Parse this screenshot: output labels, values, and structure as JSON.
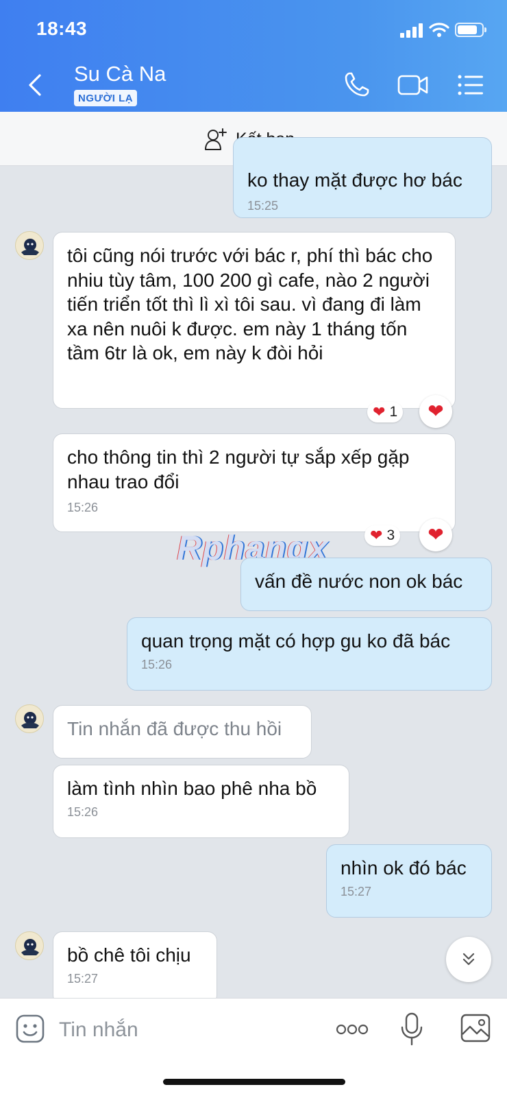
{
  "status_bar": {
    "time": "18:43"
  },
  "header": {
    "contact_name": "Su Cà Na",
    "badge": "NGƯỜI LẠ",
    "icons": [
      "back-icon",
      "phone-icon",
      "video-call-icon",
      "menu-list-icon"
    ]
  },
  "friend_bar": {
    "label": "Kết bạn",
    "icon": "add-friend-icon"
  },
  "messages": [
    {
      "dir": "out",
      "text": "ko thay mặt được hơ bác",
      "time": "15:25"
    },
    {
      "dir": "in",
      "text": "tôi cũng nói trước với bác r, phí thì bác cho nhiu tùy tâm, 100 200 gì cafe, nào 2 người tiến triển tốt thì lì xì tôi sau. vì đang đi làm xa nên nuôi k được. em này 1 tháng tốn tầm 6tr là ok, em này k đòi hỏi",
      "reaction_count": "1"
    },
    {
      "dir": "in",
      "text": "cho thông tin thì 2 người tự sắp xếp gặp nhau trao đổi",
      "time": "15:26",
      "reaction_count": "3"
    },
    {
      "dir": "out",
      "text": "vấn đề nước non ok bác"
    },
    {
      "dir": "out",
      "text": "quan trọng mặt có hợp gu ko đã bác",
      "time": "15:26"
    },
    {
      "dir": "in",
      "text": "Tin nhắn đã được thu hồi",
      "recalled": true
    },
    {
      "dir": "in",
      "text": "làm tình nhìn bao phê nha bồ",
      "time": "15:26"
    },
    {
      "dir": "out",
      "text": "nhìn ok đó bác",
      "time": "15:27"
    },
    {
      "dir": "in",
      "text": "bồ chê tôi chịu",
      "time": "15:27"
    }
  ],
  "watermark": "Rphangx",
  "composer": {
    "placeholder": "Tin nhắn",
    "icons": [
      "sticker-icon",
      "more-options-icon",
      "microphone-icon",
      "image-icon"
    ]
  },
  "colors": {
    "header": "#3f7ff0",
    "outgoing_bubble": "#d4ecfb",
    "incoming_bubble": "#ffffff",
    "chat_background": "#e1e5ea",
    "heart": "#e0222f"
  }
}
